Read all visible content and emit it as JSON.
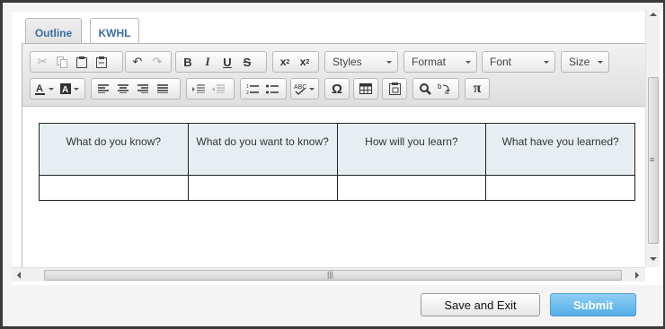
{
  "tabs": [
    {
      "label": "Outline"
    },
    {
      "label": "KWHL"
    }
  ],
  "toolbar": {
    "styles_label": "Styles",
    "format_label": "Format",
    "font_label": "Font",
    "size_label": "Size",
    "bold": "B",
    "italic": "I",
    "underline": "U",
    "strike": "S",
    "omega": "Ω",
    "pi": "π"
  },
  "table": {
    "headers": [
      "What do you know?",
      "What do you want to know?",
      "How will you learn?",
      "What have you learned?"
    ],
    "row": [
      "",
      "",
      "",
      ""
    ]
  },
  "footer": {
    "save_exit_label": "Save and Exit",
    "submit_label": "Submit"
  },
  "colors": {
    "accent_blue": "#53aee6",
    "tab_text": "#3b6ea5",
    "table_header_bg": "#e6eef2"
  }
}
